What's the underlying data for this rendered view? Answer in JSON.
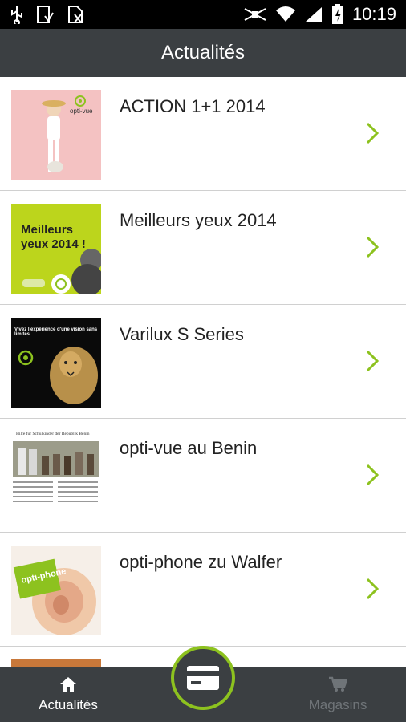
{
  "status_bar": {
    "time": "10:19"
  },
  "header": {
    "title": "Actualités"
  },
  "news": {
    "items": [
      {
        "title": "ACTION 1+1 2014",
        "thumb_text": "opti-vue"
      },
      {
        "title": "Meilleurs yeux 2014",
        "thumb_text": "Meilleurs yeux 2014 !"
      },
      {
        "title": "Varilux S Series",
        "thumb_text": "Vivez l'expérience d'une vision sans limites"
      },
      {
        "title": "opti-vue au Benin",
        "thumb_text": "Hilfe für Schulkinder der Republik Benin"
      },
      {
        "title": "opti-phone zu Walfer",
        "thumb_text": "opti-phone"
      }
    ]
  },
  "bottom_nav": {
    "news_label": "Actualités",
    "stores_label": "Magasins"
  },
  "colors": {
    "accent": "#8dc21f",
    "bar": "#3b3f42"
  }
}
